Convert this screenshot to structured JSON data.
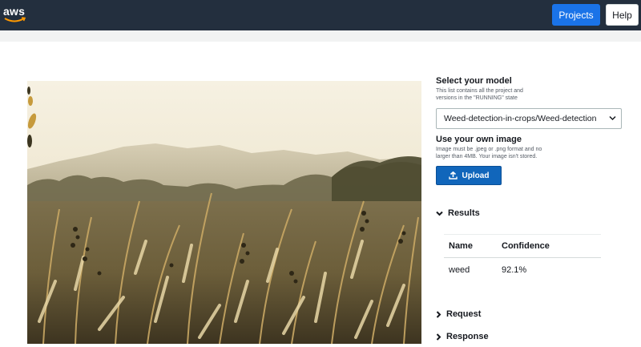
{
  "header": {
    "logo_text": "aws",
    "projects_label": "Projects",
    "help_label": "Help"
  },
  "colors": {
    "topbar": "#232f3e",
    "primary": "#1a73e8",
    "upload": "#1166bb"
  },
  "model": {
    "title": "Select your model",
    "note": "This list contains all the project and versions in the \"RUNNING\" state",
    "selected": "Weed-detection-in-crops/Weed-detection"
  },
  "own_image": {
    "title": "Use your own image",
    "note": "Image must be .jpeg or .png format and no larger than 4MB. Your image isn't stored.",
    "upload_label": "Upload"
  },
  "results": {
    "title": "Results",
    "columns": [
      "Name",
      "Confidence"
    ],
    "rows": [
      {
        "name": "weed",
        "confidence": "92.1%"
      }
    ]
  },
  "request_label": "Request",
  "response_label": "Response",
  "icons": [
    "aws-smile-icon",
    "chevron-down-icon",
    "upload-icon",
    "chevron-right-icon"
  ]
}
